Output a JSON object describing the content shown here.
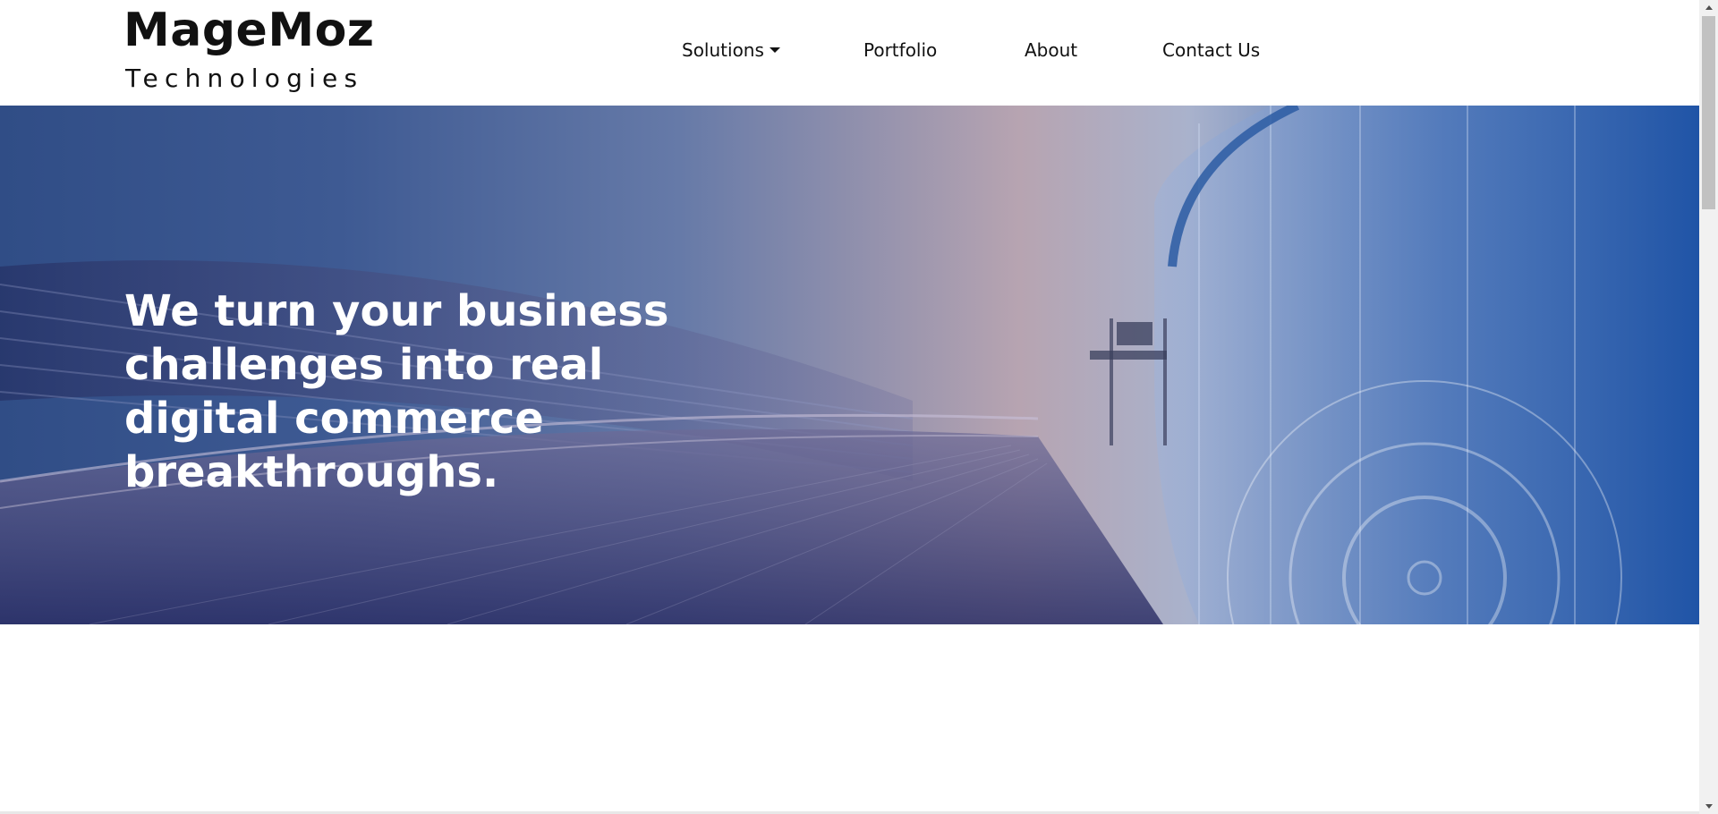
{
  "logo": {
    "main": "MageMoz",
    "sub": "Technologies"
  },
  "nav": {
    "items": [
      {
        "label": "Solutions",
        "has_dropdown": true
      },
      {
        "label": "Portfolio",
        "has_dropdown": false
      },
      {
        "label": "About",
        "has_dropdown": false
      },
      {
        "label": "Contact Us",
        "has_dropdown": false
      }
    ]
  },
  "hero": {
    "title": "We turn your business challenges into real digital commerce breakthroughs."
  },
  "colors": {
    "text": "#111111",
    "hero_text": "#ffffff",
    "hero_blue": "#304d86",
    "hero_pink": "#b7a4b1",
    "hero_bright_blue": "#245aa8"
  }
}
